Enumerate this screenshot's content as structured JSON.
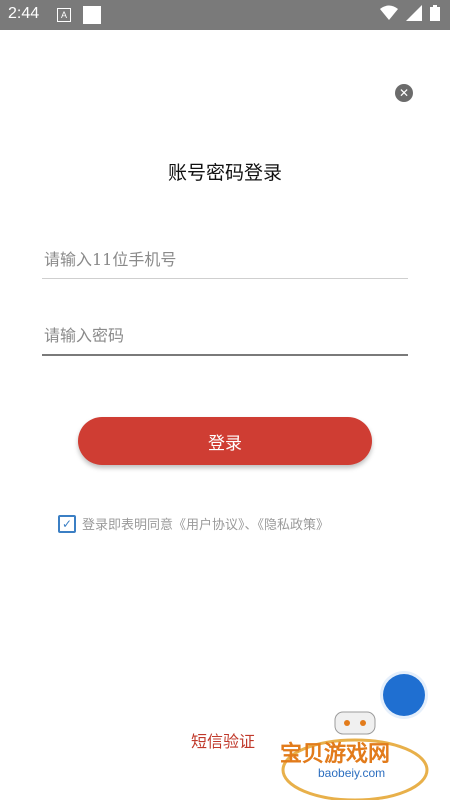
{
  "status_bar": {
    "time": "2:44",
    "badge": "A"
  },
  "page": {
    "title": "账号密码登录"
  },
  "inputs": {
    "phone_placeholder": "请输入11位手机号",
    "password_placeholder": "请输入密码"
  },
  "buttons": {
    "login": "登录",
    "sms_login": "短信验证"
  },
  "agreement": {
    "checked": true,
    "text": "登录即表明同意《用户协议》、《隐私政策》"
  },
  "watermark": {
    "title": "宝贝游戏网",
    "subtitle": "baobeiy.com"
  },
  "colors": {
    "primary": "#cf3d33",
    "link": "#c0392b",
    "checkbox": "#3b7fc4",
    "fab": "#1f6fd1"
  }
}
